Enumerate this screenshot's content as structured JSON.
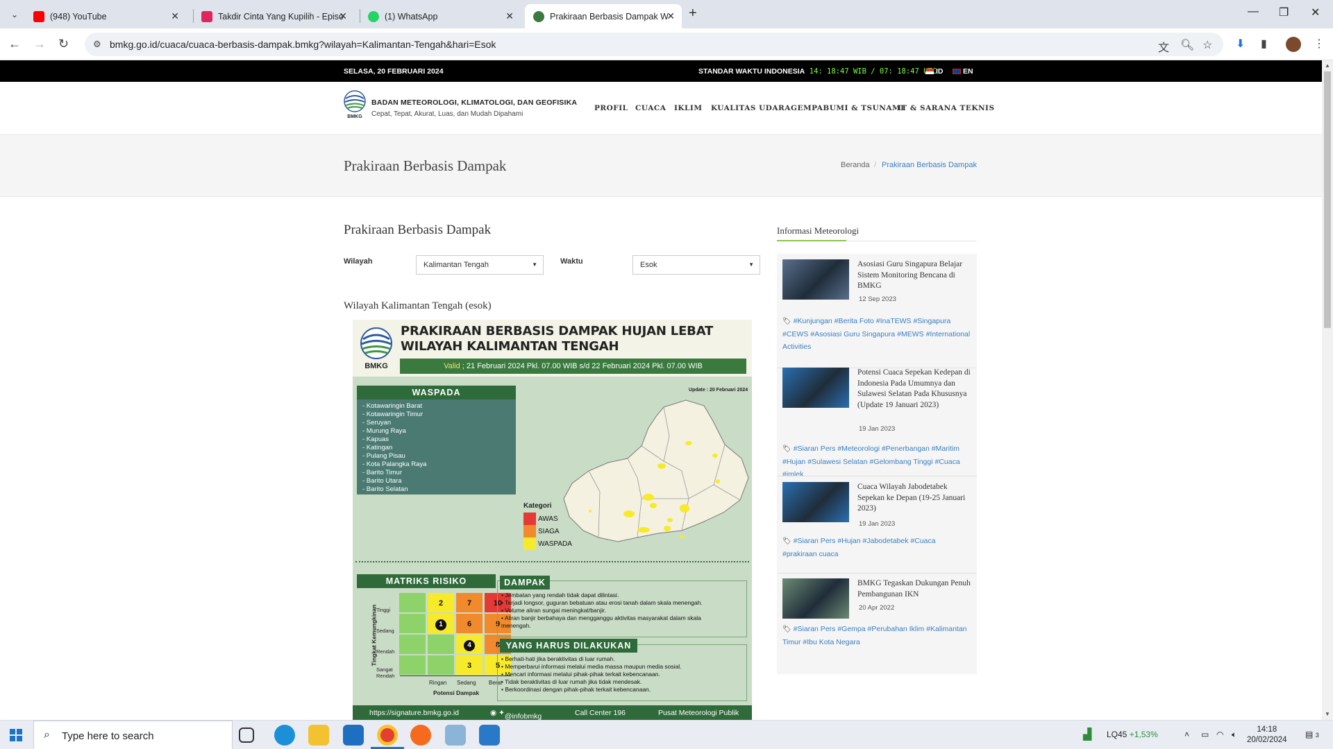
{
  "browser": {
    "tabs": [
      {
        "title": "(948) YouTube",
        "color": "#ff0000"
      },
      {
        "title": "Takdir Cinta Yang Kupilih - Episo",
        "color": "#e0245e"
      },
      {
        "title": "(1) WhatsApp",
        "color": "#25d366"
      },
      {
        "title": "Prakiraan Berbasis Dampak Wil",
        "color": "#3a7a3f"
      }
    ],
    "url": "bmkg.go.id/cuaca/cuaca-berbasis-dampak.bmkg?wilayah=Kalimantan-Tengah&hari=Esok"
  },
  "topbar": {
    "date": "SELASA, 20 FEBRUARI 2024",
    "time_label": "STANDAR WAKTU INDONESIA",
    "time_value": "14: 18:47 WIB / 07: 18:47 UTC",
    "lang_id": "ID",
    "lang_en": "EN"
  },
  "header": {
    "org_name": "BADAN METEOROLOGI, KLIMATOLOGI, DAN GEOFISIKA",
    "tagline": "Cepat, Tepat, Akurat, Luas, dan Mudah Dipahami",
    "logo_text": "BMKG",
    "nav": [
      "PROFIL",
      "CUACA",
      "IKLIM",
      "KUALITAS UDARA",
      "GEMPABUMI & TSUNAMI",
      "IT & SARANA TEKNIS"
    ]
  },
  "title_band": {
    "title": "Prakiraan Berbasis Dampak",
    "breadcrumb_home": "Beranda",
    "breadcrumb_sep": "/",
    "breadcrumb_current": "Prakiraan Berbasis Dampak"
  },
  "main": {
    "heading": "Prakiraan Berbasis Dampak",
    "wilayah_label": "Wilayah",
    "wilayah_value": "Kalimantan Tengah",
    "waktu_label": "Waktu",
    "waktu_value": "Esok",
    "region_title": "Wilayah Kalimantan Tengah (esok)"
  },
  "infographic": {
    "title_line1": "PRAKIRAAN BERBASIS DAMPAK HUJAN LEBAT",
    "title_line2": "WILAYAH KALIMANTAN TENGAH",
    "logo_text": "BMKG",
    "valid_label": "Valid",
    "valid_text": " ; 21 Februari 2024 Pkl. 07.00 WIB s/d 22 Februari 2024 Pkl. 07.00 WIB",
    "waspada_title": "WASPADA",
    "waspada_list": [
      "- Kotawaringin Barat",
      "- Kotawaringin Timur",
      "- Seruyan",
      "- Murung Raya",
      "- Kapuas",
      "- Katingan",
      "- Pulang Pisau",
      "- Kota Palangka Raya",
      "- Barito Timur",
      "- Barito Utara",
      "- Barito Selatan"
    ],
    "update_text": "Update : 20 Februari 2024",
    "kategori_title": "Kategori",
    "kategori": [
      {
        "label": "AWAS",
        "color": "#e53935"
      },
      {
        "label": "SIAGA",
        "color": "#f08a2c"
      },
      {
        "label": "WASPADA",
        "color": "#f7ea2a"
      }
    ],
    "matrix_title": "MATRIKS RISIKO",
    "matrix_ylabel": "Tingkat Kemungkinan",
    "matrix_rows": [
      "Tinggi",
      "Sedang",
      "Rendah",
      "Sangat Rendah"
    ],
    "matrix_cols": [
      "Ringan",
      "Sedang",
      "Berat"
    ],
    "matrix_xlabel": "Potensi Dampak",
    "matrix_cells": [
      {
        "label": "",
        "color": "#8ed36a"
      },
      {
        "label": "2",
        "color": "#f7ea2a"
      },
      {
        "label": "7",
        "color": "#f08a2c"
      },
      {
        "label": "10",
        "color": "#e53935"
      },
      {
        "label": "",
        "color": "#8ed36a"
      },
      {
        "label": "1",
        "color": "#f7ea2a",
        "marked": true
      },
      {
        "label": "6",
        "color": "#f08a2c"
      },
      {
        "label": "9",
        "color": "#f08a2c"
      },
      {
        "label": "",
        "color": "#8ed36a"
      },
      {
        "label": "",
        "color": "#8ed36a"
      },
      {
        "label": "4",
        "color": "#f7ea2a",
        "marked": true
      },
      {
        "label": "8",
        "color": "#f08a2c"
      },
      {
        "label": "",
        "color": "#8ed36a"
      },
      {
        "label": "",
        "color": "#8ed36a"
      },
      {
        "label": "3",
        "color": "#f7ea2a"
      },
      {
        "label": "5",
        "color": "#f7ea2a"
      }
    ],
    "dampak_title": "DAMPAK",
    "dampak_list": [
      "• Jembatan yang rendah tidak dapat dilintasi.",
      "• Terjadi longsor, guguran bebatuan atau erosi tanah dalam skala menengah.",
      "• Volume aliran sungai meningkat/banjir.",
      "• Aliran banjir berbahaya dan mengganggu aktivitas masyarakat dalam skala",
      "  menengah."
    ],
    "harus_title": "YANG HARUS DILAKUKAN",
    "harus_list": [
      "• Berhati-hati jika beraktivitas di luar rumah.",
      "• Memperbarui informasi melalui media massa maupun media sosial.",
      "• Mencari informasi melalui pihak-pihak terkait kebencanaan.",
      "• Tidak beraktivitas di luar rumah jika tidak mendesak.",
      "• Berkoordinasi dengan pihak-pihak terkait kebencanaan."
    ],
    "footer_url": "https://signature.bmkg.go.id",
    "footer_social": "@infobmkg",
    "footer_call": "Call Center 196",
    "footer_pusat": "Pusat Meteorologi Publik"
  },
  "sidebar": {
    "title": "Informasi Meteorologi",
    "news": [
      {
        "title": "Asosiasi Guru Singapura Belajar Sistem Monitoring Bencana di BMKG",
        "date": "12 Sep 2023",
        "tags": "#Kunjungan #Berita Foto #InaTEWS #Singapura #CEWS #Asosiasi Guru Singapura #MEWS #International Activities",
        "thumb": "#5a6f8c"
      },
      {
        "title": "Potensi Cuaca Sepekan Kedepan di Indonesia Pada Umumnya dan Sulawesi Selatan Pada Khususnya (Update 19 Januari 2023)",
        "date": "19 Jan 2023",
        "tags": "#Siaran Pers #Meteorologi #Penerbangan #Maritim #Hujan #Sulawesi Selatan #Gelombang Tinggi #Cuaca #imlek",
        "thumb": "#2a6fb0"
      },
      {
        "title": "Cuaca Wilayah Jabodetabek Sepekan ke Depan (19-25 Januari 2023)",
        "date": "19 Jan 2023",
        "tags": "#Siaran Pers #Hujan #Jabodetabek #Cuaca #prakiraan cuaca",
        "thumb": "#2a6fb0"
      },
      {
        "title": "BMKG Tegaskan Dukungan Penuh Pembangunan IKN",
        "date": "20 Apr 2022",
        "tags": "#Siaran Pers #Gempa #Perubahan Iklim #Kalimantan Timur #Ibu Kota Negara",
        "thumb": "#6c8a74"
      }
    ]
  },
  "taskbar": {
    "search_placeholder": "Type here to search",
    "stock_name": "LQ45",
    "stock_change": "+1,53%",
    "time": "14:18",
    "date": "20/02/2024",
    "notif_count": "3"
  }
}
